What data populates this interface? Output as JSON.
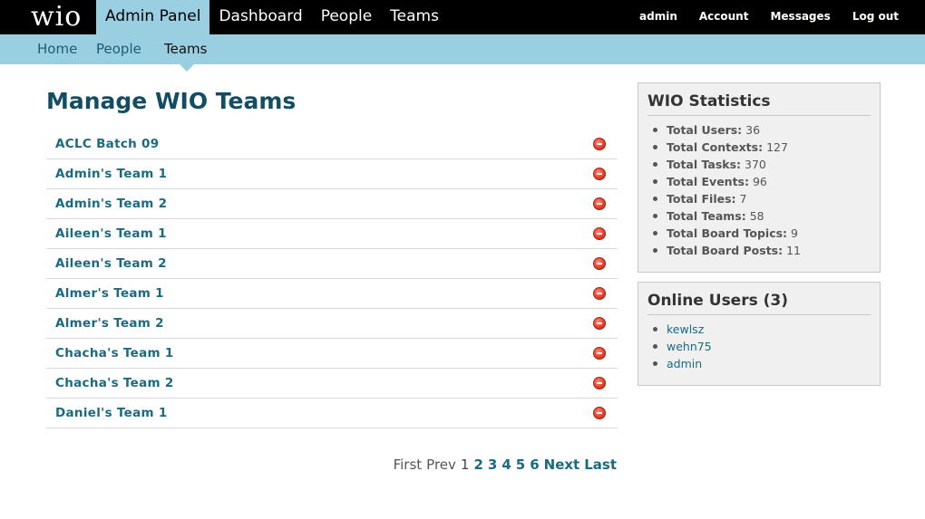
{
  "topbar": {
    "logo": "wio",
    "main_nav": [
      "Admin Panel",
      "Dashboard",
      "People",
      "Teams"
    ],
    "user_nav": [
      "admin",
      "Account",
      "Messages",
      "Log out"
    ]
  },
  "subnav": {
    "items": [
      "Home",
      "People",
      "Teams"
    ]
  },
  "main": {
    "title": "Manage WIO Teams",
    "teams": [
      "ACLC Batch 09",
      "Admin's Team 1",
      "Admin's Team 2",
      "Aileen's Team 1",
      "Aileen's Team 2",
      "Almer's Team 1",
      "Almer's Team 2",
      "Chacha's Team 1",
      "Chacha's Team 2",
      "Daniel's Team 1"
    ],
    "pager": {
      "first": "First",
      "prev": "Prev",
      "current": "1",
      "pages": [
        "2",
        "3",
        "4",
        "5",
        "6"
      ],
      "next": "Next",
      "last": "Last"
    }
  },
  "stats": {
    "title": "WIO Statistics",
    "items": [
      {
        "label": "Total Users:",
        "value": "36"
      },
      {
        "label": "Total Contexts:",
        "value": "127"
      },
      {
        "label": "Total Tasks:",
        "value": "370"
      },
      {
        "label": "Total Events:",
        "value": "96"
      },
      {
        "label": "Total Files:",
        "value": "7"
      },
      {
        "label": "Total Teams:",
        "value": "58"
      },
      {
        "label": "Total Board Topics:",
        "value": "9"
      },
      {
        "label": "Total Board Posts:",
        "value": "11"
      }
    ]
  },
  "online": {
    "title": "Online Users (3)",
    "users": [
      "kewlsz",
      "wehn75",
      "admin"
    ]
  },
  "colors": {
    "accent": "#99cfe0",
    "link": "#1a6a82",
    "title": "#134d63",
    "topbar": "#000000"
  }
}
